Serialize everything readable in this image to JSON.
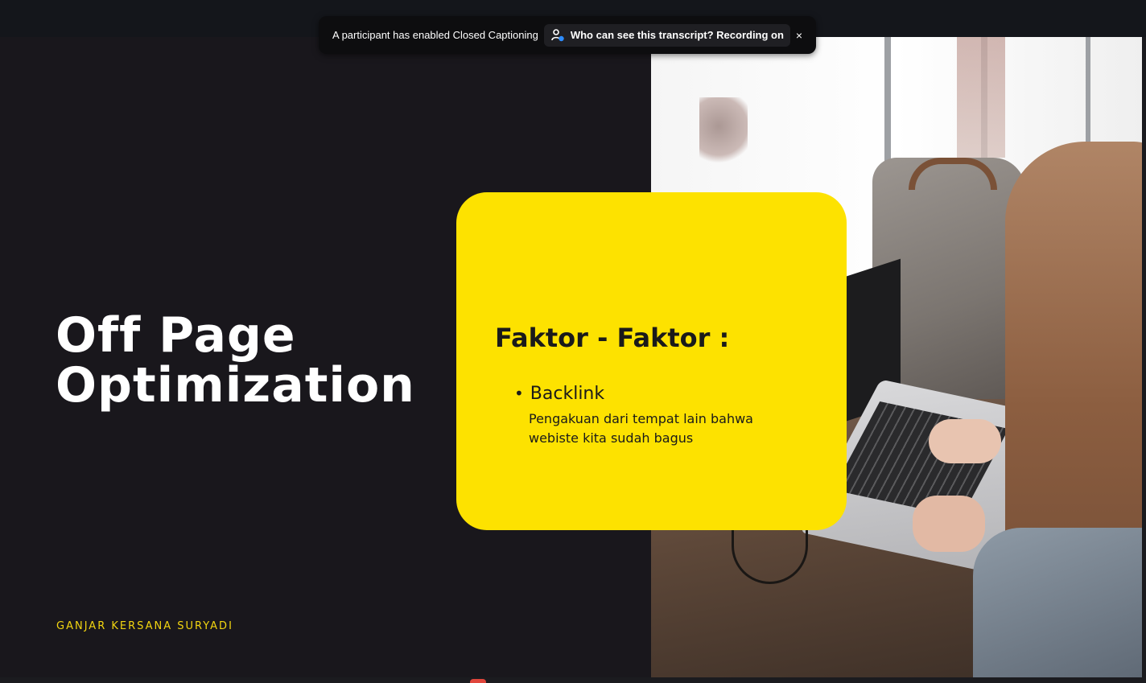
{
  "slide": {
    "title_line1": "Off Page",
    "title_line2": "Optimization",
    "author": "GANJAR KERSANA SURYADI",
    "card": {
      "heading": "Faktor - Faktor :",
      "bullet": "Backlink",
      "description": "Pengakuan dari tempat lain bahwa webiste kita sudah bagus"
    }
  },
  "notification": {
    "message": "A participant has enabled Closed Captioning",
    "link_label": "Who can see this transcript? Recording on",
    "close_label": "×"
  },
  "colors": {
    "accent_yellow": "#fde200",
    "author_yellow": "#f2d510",
    "background": "#19171c"
  }
}
